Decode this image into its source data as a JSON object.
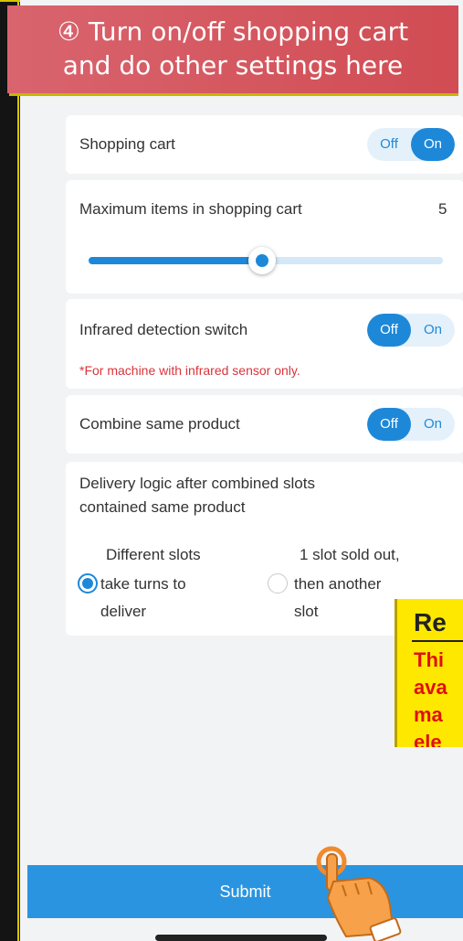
{
  "banner": {
    "line1": "④ Turn on/off shopping cart",
    "line2": "and do other settings here"
  },
  "shopping_cart": {
    "label": "Shopping cart",
    "off": "Off",
    "on": "On",
    "state": "On"
  },
  "max_items": {
    "label": "Maximum items in shopping cart",
    "value": "5",
    "slider_fraction": 0.49
  },
  "infrared": {
    "label": "Infrared detection switch",
    "off": "Off",
    "on": "On",
    "state": "Off",
    "note": "*For machine with infrared sensor only."
  },
  "combine": {
    "label": "Combine same product",
    "off": "Off",
    "on": "On",
    "state": "Off"
  },
  "delivery": {
    "line1": "Delivery logic after combined slots",
    "line2": "contained same product",
    "option1": {
      "lines": [
        "Different slots",
        "take turns to",
        "deliver"
      ],
      "checked": true
    },
    "option2": {
      "lines": [
        "1 slot sold out,",
        "then another",
        "slot"
      ],
      "checked": false
    }
  },
  "notice": {
    "title": "Re",
    "lines": [
      "Thi",
      "ava",
      "ma",
      "ele"
    ]
  },
  "submit_label": "Submit",
  "colors": {
    "accent": "#1e88d8",
    "banner": "#d14c53",
    "notice_bg": "#ffe800",
    "notice_text": "#e01010"
  }
}
